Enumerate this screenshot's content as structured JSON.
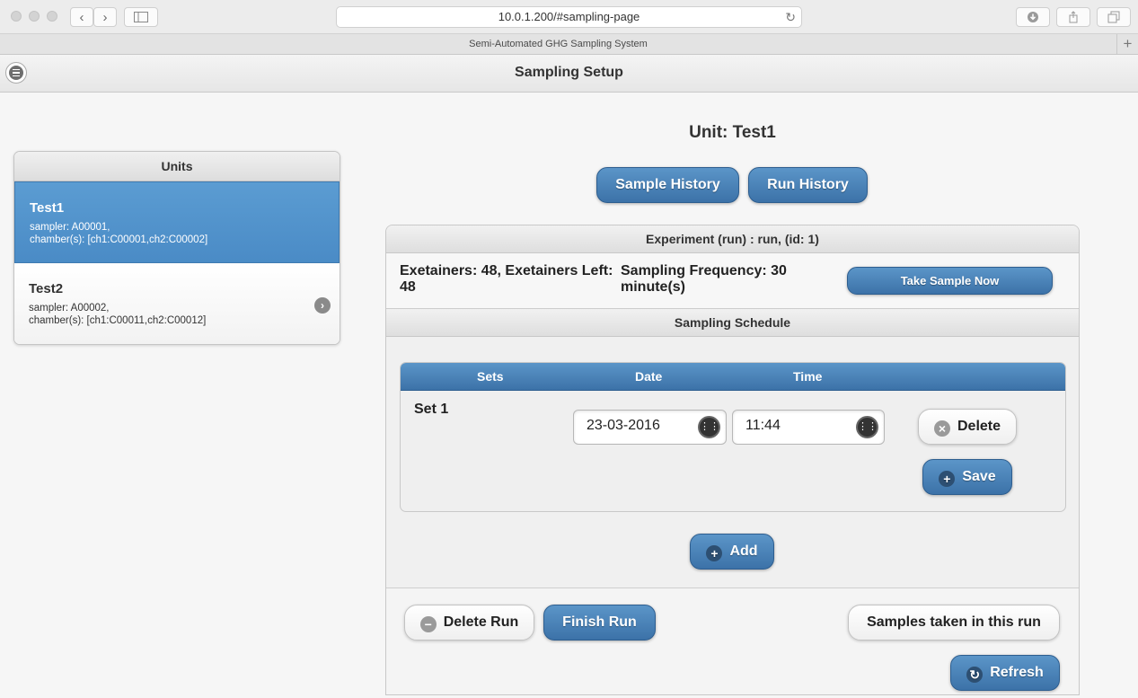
{
  "browser": {
    "url": "10.0.1.200/#sampling-page",
    "tab_title": "Semi-Automated GHG Sampling System",
    "back_icon": "‹",
    "forward_icon": "›",
    "reload_icon": "↻",
    "new_tab_icon": "+"
  },
  "header": {
    "title": "Sampling Setup"
  },
  "units": {
    "heading": "Units",
    "items": [
      {
        "name": "Test1",
        "sampler": "sampler: A00001,",
        "chambers": "chamber(s): [ch1:C00001,ch2:C00002]"
      },
      {
        "name": "Test2",
        "sampler": "sampler: A00002,",
        "chambers": "chamber(s): [ch1:C00011,ch2:C00012]"
      }
    ],
    "chevron": "›"
  },
  "main": {
    "unit_title": "Unit: Test1",
    "sample_history_label": "Sample History",
    "run_history_label": "Run History",
    "experiment_header": "Experiment (run) : run,   (id: 1)",
    "exetainers_text": "Exetainers: 48, Exetainers Left: 48",
    "frequency_text": "Sampling Frequency: 30 minute(s)",
    "take_sample_label": "Take Sample Now",
    "schedule_header": "Sampling Schedule",
    "schedule_columns": {
      "sets": "Sets",
      "date": "Date",
      "time": "Time"
    },
    "set": {
      "label": "Set 1",
      "date": "23-03-2016",
      "time": "11:44",
      "delete_label": "Delete",
      "save_label": "Save"
    },
    "add_label": "Add",
    "delete_run_label": "Delete Run",
    "finish_run_label": "Finish Run",
    "samples_taken_label": "Samples taken in this run",
    "refresh_label": "Refresh"
  },
  "icons": {
    "delete": "×",
    "plus": "+",
    "minus": "−",
    "refresh": "↻",
    "calendar": "⋮⋮⋮"
  },
  "colors": {
    "accent_blue": "#4a8bc6",
    "button_blue": "#3c72a8"
  }
}
